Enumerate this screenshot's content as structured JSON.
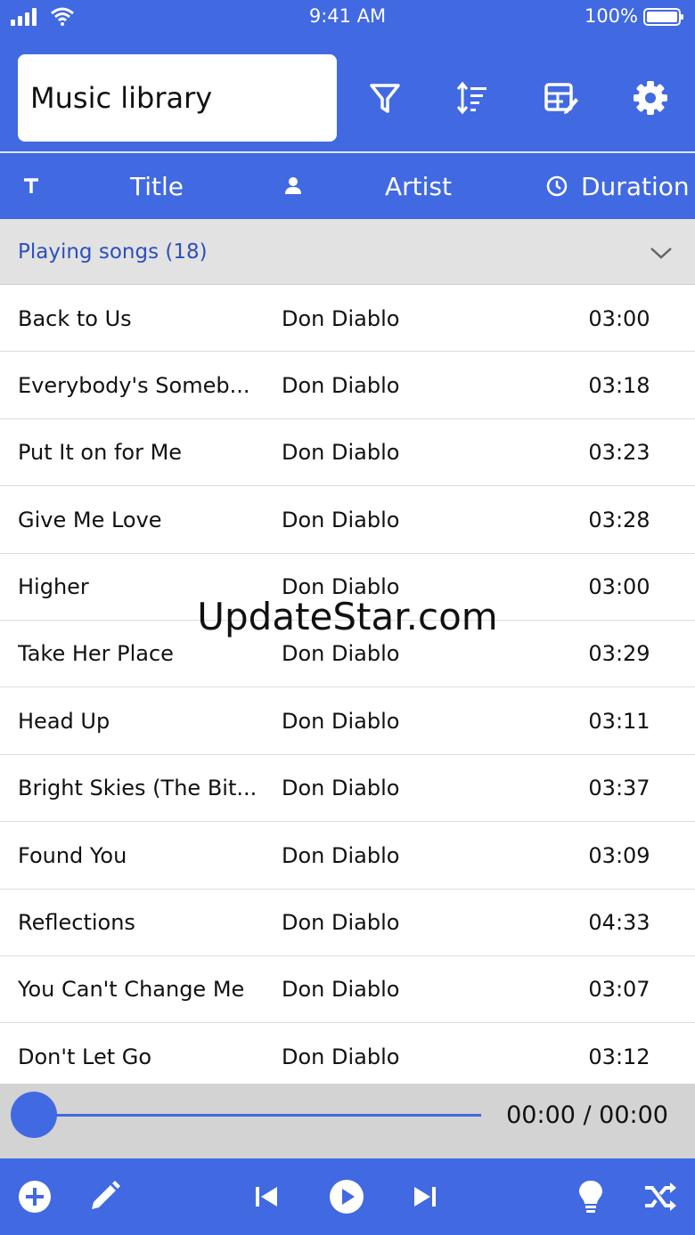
{
  "status_bar": {
    "time": "9:41 AM",
    "battery_text": "100%"
  },
  "header": {
    "title": "Music library"
  },
  "toolbar_icons": [
    "filter-icon",
    "sort-icon",
    "edit-table-icon",
    "gear-icon"
  ],
  "columns": [
    {
      "icon": "text-icon",
      "label": "Title"
    },
    {
      "icon": "person-icon",
      "label": "Artist"
    },
    {
      "icon": "clock-icon",
      "label": "Duration"
    }
  ],
  "group": {
    "label": "Playing songs (18)"
  },
  "songs": [
    {
      "title": "Back to Us",
      "artist": "Don Diablo",
      "duration": "03:00"
    },
    {
      "title": "Everybody's Someb...",
      "artist": "Don Diablo",
      "duration": "03:18"
    },
    {
      "title": "Put It on for Me",
      "artist": "Don Diablo",
      "duration": "03:23"
    },
    {
      "title": "Give Me Love",
      "artist": "Don Diablo",
      "duration": "03:28"
    },
    {
      "title": "Higher",
      "artist": "Don Diablo",
      "duration": "03:00"
    },
    {
      "title": "Take Her Place",
      "artist": "Don Diablo",
      "duration": "03:29"
    },
    {
      "title": "Head Up",
      "artist": "Don Diablo",
      "duration": "03:11"
    },
    {
      "title": "Bright Skies (The Bit...",
      "artist": "Don Diablo",
      "duration": "03:37"
    },
    {
      "title": "Found You",
      "artist": "Don Diablo",
      "duration": "03:09"
    },
    {
      "title": "Reflections",
      "artist": "Don Diablo",
      "duration": "04:33"
    },
    {
      "title": "You Can't Change Me",
      "artist": "Don Diablo",
      "duration": "03:07"
    },
    {
      "title": "Don't Let Go",
      "artist": "Don Diablo",
      "duration": "03:12"
    }
  ],
  "watermark": "UpdateStar.com",
  "player": {
    "time": "00:00 / 00:00",
    "progress": 0
  },
  "bottom_icons": [
    "add-icon",
    "pencil-icon",
    "previous-icon",
    "play-icon",
    "next-icon",
    "lightbulb-icon",
    "shuffle-icon"
  ],
  "colors": {
    "accent": "#4169e1",
    "group_bg": "#e2e2e2",
    "group_text": "#2d50b8",
    "player_bg": "#d3d3d3"
  }
}
